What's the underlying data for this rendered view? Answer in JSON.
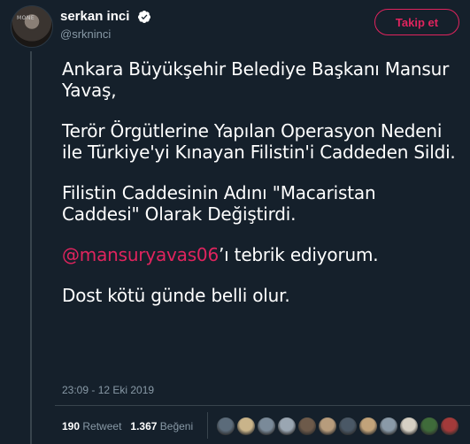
{
  "author": {
    "display_name": "serkan inci",
    "handle": "@srkninci",
    "avatar_watermark": "MONE"
  },
  "follow_button": {
    "label": "Takip et"
  },
  "tweet": {
    "lines": [
      "Ankara Büyükşehir Belediye Başkanı Mansur Yavaş,",
      "Terör Örgütlerine Yapılan Operasyon Nedeni ile Türkiye'yi Kınayan Filistin'i Caddeden Sildi.",
      "Filistin Caddesinin Adını \"Macaristan Caddesi\" Olarak Değiştirdi."
    ],
    "mention": "@mansuryavas06",
    "mention_suffix": "’ı tebrik ediyorum.",
    "closing": "Dost kötü günde belli olur."
  },
  "timestamp": "23:09 - 12 Eki 2019",
  "stats": {
    "retweets_count": "190",
    "retweets_label": "Retweet",
    "likes_count": "1.367",
    "likes_label": "Beğeni"
  },
  "likers": {
    "colors": [
      "#5b6b7a",
      "#c9b48a",
      "#7a8a99",
      "#9aa6b2",
      "#6d5a4a",
      "#b79c7c",
      "#4a5866",
      "#c2a37a",
      "#8a9aa8",
      "#d6d0c4",
      "#3f6b3a",
      "#a33a3a"
    ]
  },
  "colors": {
    "background": "#15202b",
    "accent": "#e0245e",
    "muted": "#8899a6",
    "verified": "#ffffff"
  },
  "icons": {
    "verified": "verified-badge-icon"
  }
}
